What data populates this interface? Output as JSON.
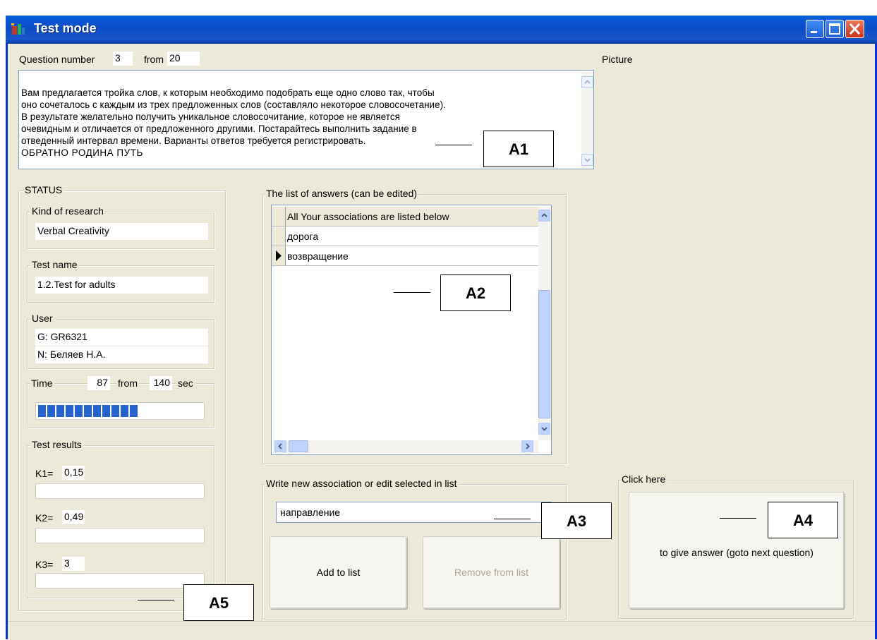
{
  "window": {
    "title": "Test mode",
    "titlebar_color": "#0c4cc7",
    "buttons": [
      "minimize-icon",
      "maximize-icon",
      "close-icon"
    ]
  },
  "question": {
    "label": "Question number",
    "number": "3",
    "from_label": "from",
    "total": "20",
    "text": "Вам предлагается тройка слов, к которым необходимо подобрать еще одно слово так, чтобы\nоно сочеталось с каждым из трех предложенных слов (составляло некоторое словосочетание).\nВ результате желательно получить уникальное словосочитание, которое не является\nочевидным и отличается от предложенного другими. Постарайтесь выполнить задание в\nотведенный интервал времени. Варианты ответов требуется регистрировать.",
    "words": "ОБРАТНО РОДИНА ПУТЬ"
  },
  "picture_label": "Picture",
  "status": {
    "title": "STATUS",
    "research": {
      "label": "Kind of research",
      "value": "Verbal Creativity"
    },
    "test": {
      "label": "Test name",
      "value": "1.2.Test for adults"
    },
    "user": {
      "label": "User",
      "group": "G: GR6321",
      "name": "N: Беляев Н.А."
    },
    "time": {
      "label": "Time",
      "elapsed": "87",
      "from_label": "from",
      "total": "140",
      "unit": "sec",
      "progress_fraction": 0.62
    },
    "results": {
      "label": "Test results",
      "k1": {
        "label": "K1=",
        "value": "0,15"
      },
      "k2": {
        "label": "K2=",
        "value": "0,49"
      },
      "k3": {
        "label": "K3=",
        "value": "3"
      }
    }
  },
  "answers": {
    "title": "The list of answers (can be edited)",
    "header": "All Your associations are listed below",
    "rows": [
      "дорога",
      "возвращение"
    ],
    "selected_row": 1
  },
  "entry": {
    "title": "Write new association or edit selected in list",
    "value": "направление",
    "add_label": "Add to list",
    "remove_label": "Remove from list"
  },
  "submit": {
    "title": "Click here",
    "label": "to give answer (goto next question)"
  },
  "callouts": {
    "a1": "A1",
    "a2": "A2",
    "a3": "A3",
    "a4": "A4",
    "a5": "A5"
  }
}
